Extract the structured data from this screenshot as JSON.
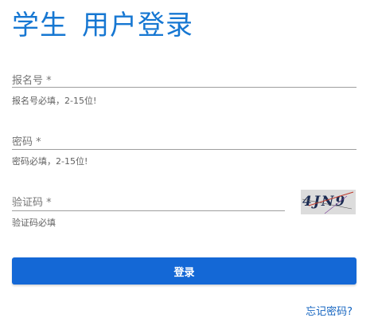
{
  "header": {
    "role": "学生",
    "title": "用户登录"
  },
  "form": {
    "registration_label": "报名号 *",
    "registration_hint": "报名号必填，2-15位!",
    "password_label": "密码 *",
    "password_hint": "密码必填，2-15位!",
    "captcha_label": "验证码 *",
    "captcha_hint": "验证码必填",
    "captcha_text": "4JN9"
  },
  "actions": {
    "login_label": "登录",
    "forgot_label": "忘记密码?"
  },
  "colors": {
    "accent": "#1677d2",
    "button": "#1468d6"
  }
}
